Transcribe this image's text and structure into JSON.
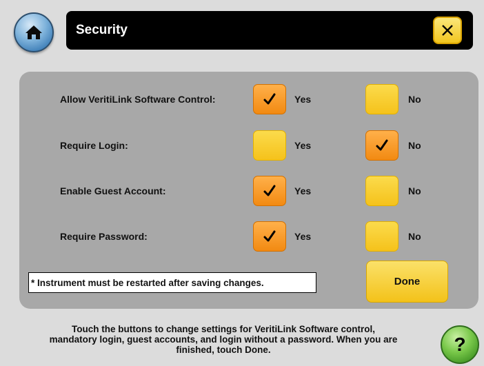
{
  "header": {
    "title": "Security",
    "home_icon": "home-icon",
    "close_icon": "close-icon"
  },
  "settings": [
    {
      "label": "Allow VeritiLink Software Control:",
      "yes_label": "Yes",
      "no_label": "No",
      "selected": "yes"
    },
    {
      "label": "Require Login:",
      "yes_label": "Yes",
      "no_label": "No",
      "selected": "no"
    },
    {
      "label": "Enable Guest Account:",
      "yes_label": "Yes",
      "no_label": "No",
      "selected": "yes"
    },
    {
      "label": "Require Password:",
      "yes_label": "Yes",
      "no_label": "No",
      "selected": "yes"
    }
  ],
  "note": "* Instrument must be restarted after saving changes.",
  "done_label": "Done",
  "help": {
    "text": "Touch the buttons to change settings for VeritiLink Software control, mandatory login, guest accounts, and login without a password. When you are finished, touch Done.",
    "button_label": "?"
  },
  "colors": {
    "checked": "#f28a12",
    "unchecked": "#f5c21b",
    "panel": "#a8a8a8",
    "title_bar": "#000000"
  }
}
